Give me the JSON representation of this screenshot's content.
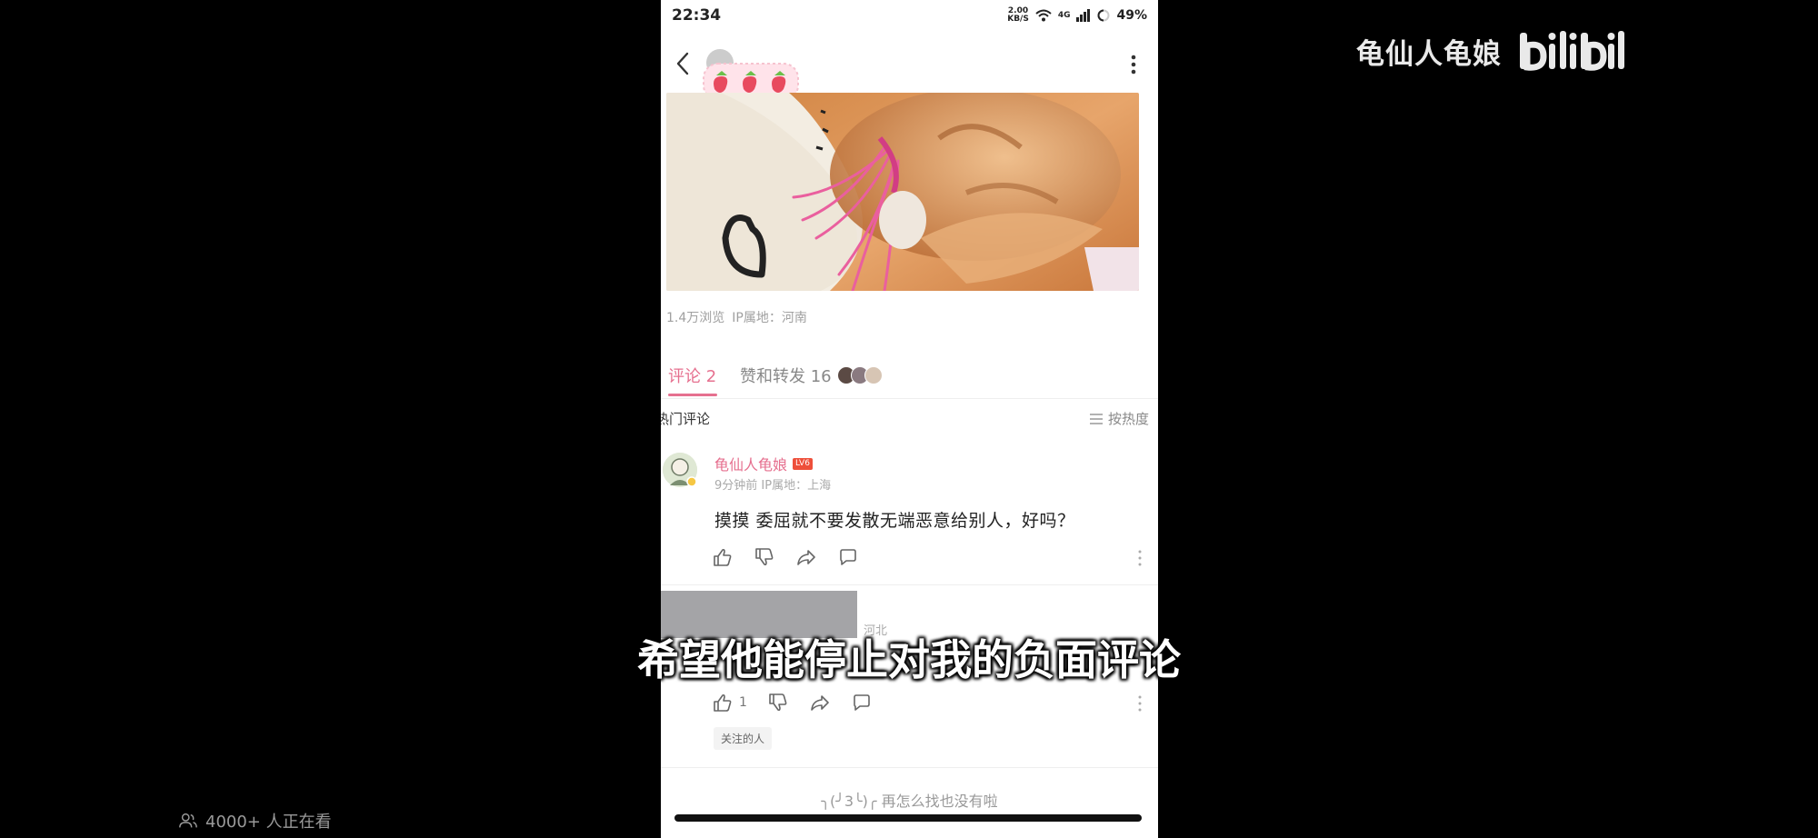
{
  "watermark": {
    "text": "龟仙人龟娘",
    "logo": "bilibili"
  },
  "viewers": {
    "icon": "people-icon",
    "text": "4000+ 人正在看"
  },
  "status_bar": {
    "time": "22:34",
    "net_speed_top": "2.00",
    "net_speed_bottom": "KB/S",
    "cellular": "4G",
    "battery": "49%"
  },
  "post": {
    "meta_views": "1.4万浏览",
    "meta_ip": "IP属地：河南"
  },
  "tabs": {
    "comments": "评论 2",
    "likes": "赞和转发 16"
  },
  "comments_section": {
    "hot_title": "热门评论",
    "sort_label": "按热度"
  },
  "comment1": {
    "username": "龟仙人龟娘",
    "level": "LV6",
    "meta": "9分钟前 IP属地：上海",
    "text": "摸摸   委屈就不要发散无端恶意给别人，好吗？"
  },
  "comment2": {
    "location": "河北",
    "like_count": "1",
    "tag": "关注的人"
  },
  "footer_tip": "╮(╯3╰)╭ 再怎么找也没有啦",
  "subtitle": "希望他能停止对我的负面评论",
  "colors": {
    "accent_pink": "#e6708f",
    "level_red": "#ee4f3a",
    "background": "#000000"
  }
}
